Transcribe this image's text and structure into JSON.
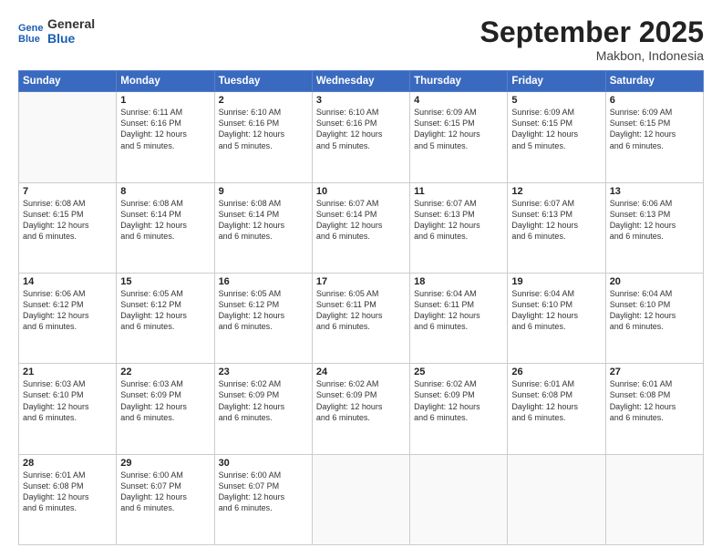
{
  "header": {
    "logo_line1": "General",
    "logo_line2": "Blue",
    "month": "September 2025",
    "location": "Makbon, Indonesia"
  },
  "weekdays": [
    "Sunday",
    "Monday",
    "Tuesday",
    "Wednesday",
    "Thursday",
    "Friday",
    "Saturday"
  ],
  "weeks": [
    [
      {
        "day": "",
        "info": ""
      },
      {
        "day": "1",
        "info": "Sunrise: 6:11 AM\nSunset: 6:16 PM\nDaylight: 12 hours\nand 5 minutes."
      },
      {
        "day": "2",
        "info": "Sunrise: 6:10 AM\nSunset: 6:16 PM\nDaylight: 12 hours\nand 5 minutes."
      },
      {
        "day": "3",
        "info": "Sunrise: 6:10 AM\nSunset: 6:16 PM\nDaylight: 12 hours\nand 5 minutes."
      },
      {
        "day": "4",
        "info": "Sunrise: 6:09 AM\nSunset: 6:15 PM\nDaylight: 12 hours\nand 5 minutes."
      },
      {
        "day": "5",
        "info": "Sunrise: 6:09 AM\nSunset: 6:15 PM\nDaylight: 12 hours\nand 5 minutes."
      },
      {
        "day": "6",
        "info": "Sunrise: 6:09 AM\nSunset: 6:15 PM\nDaylight: 12 hours\nand 6 minutes."
      }
    ],
    [
      {
        "day": "7",
        "info": "Sunrise: 6:08 AM\nSunset: 6:15 PM\nDaylight: 12 hours\nand 6 minutes."
      },
      {
        "day": "8",
        "info": "Sunrise: 6:08 AM\nSunset: 6:14 PM\nDaylight: 12 hours\nand 6 minutes."
      },
      {
        "day": "9",
        "info": "Sunrise: 6:08 AM\nSunset: 6:14 PM\nDaylight: 12 hours\nand 6 minutes."
      },
      {
        "day": "10",
        "info": "Sunrise: 6:07 AM\nSunset: 6:14 PM\nDaylight: 12 hours\nand 6 minutes."
      },
      {
        "day": "11",
        "info": "Sunrise: 6:07 AM\nSunset: 6:13 PM\nDaylight: 12 hours\nand 6 minutes."
      },
      {
        "day": "12",
        "info": "Sunrise: 6:07 AM\nSunset: 6:13 PM\nDaylight: 12 hours\nand 6 minutes."
      },
      {
        "day": "13",
        "info": "Sunrise: 6:06 AM\nSunset: 6:13 PM\nDaylight: 12 hours\nand 6 minutes."
      }
    ],
    [
      {
        "day": "14",
        "info": "Sunrise: 6:06 AM\nSunset: 6:12 PM\nDaylight: 12 hours\nand 6 minutes."
      },
      {
        "day": "15",
        "info": "Sunrise: 6:05 AM\nSunset: 6:12 PM\nDaylight: 12 hours\nand 6 minutes."
      },
      {
        "day": "16",
        "info": "Sunrise: 6:05 AM\nSunset: 6:12 PM\nDaylight: 12 hours\nand 6 minutes."
      },
      {
        "day": "17",
        "info": "Sunrise: 6:05 AM\nSunset: 6:11 PM\nDaylight: 12 hours\nand 6 minutes."
      },
      {
        "day": "18",
        "info": "Sunrise: 6:04 AM\nSunset: 6:11 PM\nDaylight: 12 hours\nand 6 minutes."
      },
      {
        "day": "19",
        "info": "Sunrise: 6:04 AM\nSunset: 6:10 PM\nDaylight: 12 hours\nand 6 minutes."
      },
      {
        "day": "20",
        "info": "Sunrise: 6:04 AM\nSunset: 6:10 PM\nDaylight: 12 hours\nand 6 minutes."
      }
    ],
    [
      {
        "day": "21",
        "info": "Sunrise: 6:03 AM\nSunset: 6:10 PM\nDaylight: 12 hours\nand 6 minutes."
      },
      {
        "day": "22",
        "info": "Sunrise: 6:03 AM\nSunset: 6:09 PM\nDaylight: 12 hours\nand 6 minutes."
      },
      {
        "day": "23",
        "info": "Sunrise: 6:02 AM\nSunset: 6:09 PM\nDaylight: 12 hours\nand 6 minutes."
      },
      {
        "day": "24",
        "info": "Sunrise: 6:02 AM\nSunset: 6:09 PM\nDaylight: 12 hours\nand 6 minutes."
      },
      {
        "day": "25",
        "info": "Sunrise: 6:02 AM\nSunset: 6:09 PM\nDaylight: 12 hours\nand 6 minutes."
      },
      {
        "day": "26",
        "info": "Sunrise: 6:01 AM\nSunset: 6:08 PM\nDaylight: 12 hours\nand 6 minutes."
      },
      {
        "day": "27",
        "info": "Sunrise: 6:01 AM\nSunset: 6:08 PM\nDaylight: 12 hours\nand 6 minutes."
      }
    ],
    [
      {
        "day": "28",
        "info": "Sunrise: 6:01 AM\nSunset: 6:08 PM\nDaylight: 12 hours\nand 6 minutes."
      },
      {
        "day": "29",
        "info": "Sunrise: 6:00 AM\nSunset: 6:07 PM\nDaylight: 12 hours\nand 6 minutes."
      },
      {
        "day": "30",
        "info": "Sunrise: 6:00 AM\nSunset: 6:07 PM\nDaylight: 12 hours\nand 6 minutes."
      },
      {
        "day": "",
        "info": ""
      },
      {
        "day": "",
        "info": ""
      },
      {
        "day": "",
        "info": ""
      },
      {
        "day": "",
        "info": ""
      }
    ]
  ]
}
